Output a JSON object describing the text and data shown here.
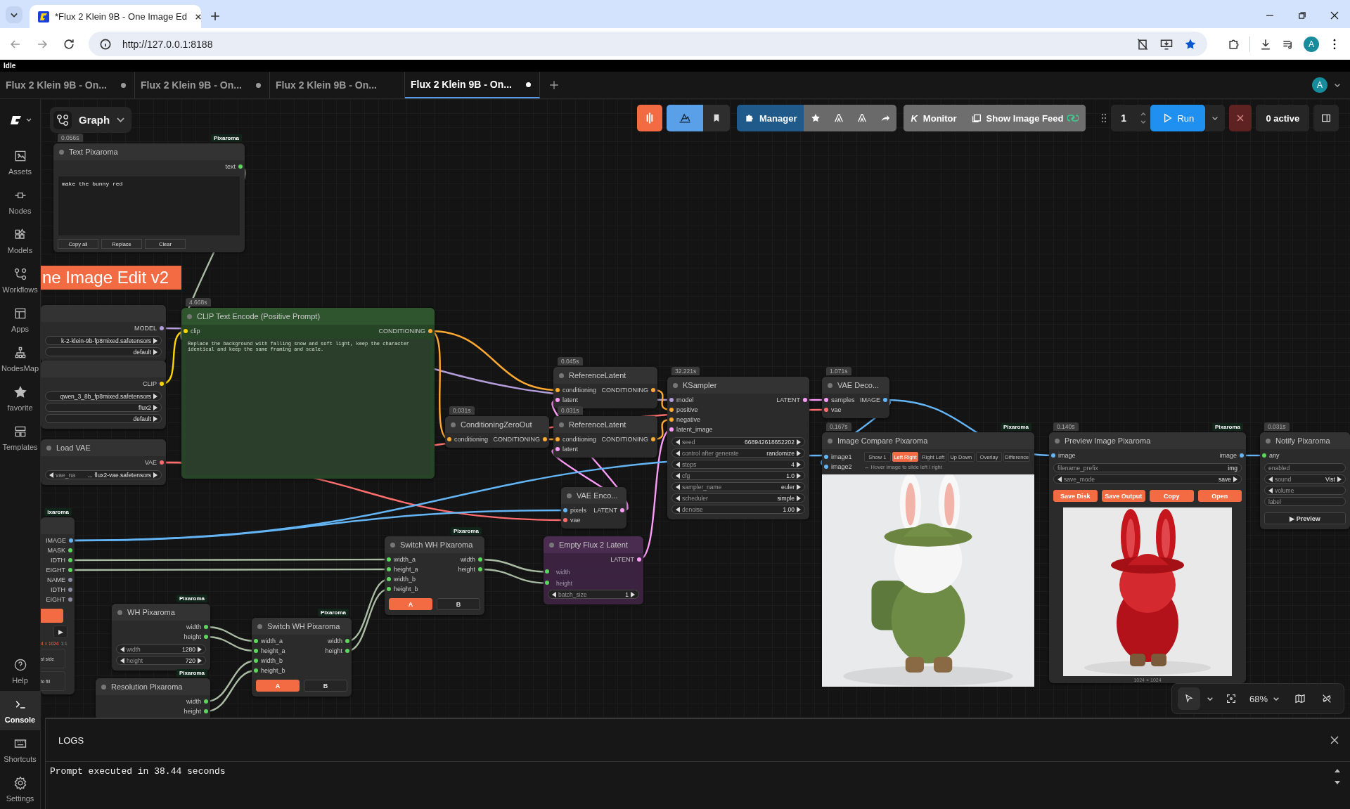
{
  "browser": {
    "tab_title": "*Flux 2 Klein 9B - One Image Ed",
    "url": "http://127.0.0.1:8188",
    "profile": "A"
  },
  "status": "Idle",
  "workflow_tabs": [
    {
      "label": "Flux 2 Klein 9B - On...",
      "unsaved": true,
      "selected": false
    },
    {
      "label": "Flux 2 Klein 9B - On...",
      "unsaved": true,
      "selected": false
    },
    {
      "label": "Flux 2 Klein 9B - On...",
      "unsaved": false,
      "selected": false
    },
    {
      "label": "Flux 2 Klein 9B - On...",
      "unsaved": true,
      "selected": true
    }
  ],
  "account": "A",
  "sidebar": {
    "items": [
      {
        "label": "Assets",
        "selected": false
      },
      {
        "label": "Nodes",
        "selected": false
      },
      {
        "label": "Models",
        "selected": false
      },
      {
        "label": "Workflows",
        "selected": false
      },
      {
        "label": "Apps",
        "selected": false
      },
      {
        "label": "NodesMap",
        "selected": false
      },
      {
        "label": "favorite",
        "selected": false
      },
      {
        "label": "Templates",
        "selected": false
      }
    ],
    "bottom_items": [
      {
        "label": "Help",
        "selected": false
      },
      {
        "label": "Console",
        "selected": true
      },
      {
        "label": "Shortcuts",
        "selected": false
      },
      {
        "label": "Settings",
        "selected": false
      }
    ]
  },
  "view_menu": "Graph",
  "toolbar": {
    "manager": "Manager",
    "monitor_mark": "K",
    "monitor": "Monitor",
    "image_feed": "Show Image Feed",
    "batch_count": "1",
    "run": "Run",
    "queue_status": "0 active"
  },
  "group_title": "ne Image Edit v2",
  "nodes": [
    {
      "kind": "text_editor",
      "title": "Text Pixaroma",
      "timing": "0.056s",
      "badge": "Pixaroma",
      "outputs": [
        {
          "label": "text",
          "color": "#5cd65c"
        }
      ],
      "text": "make the bunny red",
      "buttons": [
        {
          "label": "Copy all"
        },
        {
          "label": "Replace"
        },
        {
          "label": "Clear"
        }
      ]
    },
    {
      "kind": "standard",
      "outputs": [
        {
          "label": "MODEL",
          "color": "#b39ddb"
        }
      ],
      "widgets": [
        {
          "kind": "combo",
          "value": "k-2-klein-9b-fp8mixed.safetensors"
        },
        {
          "kind": "combo",
          "value": "default"
        }
      ]
    },
    {
      "kind": "standard",
      "outputs": [
        {
          "label": "CLIP",
          "color": "#ffd500"
        }
      ],
      "widgets": [
        {
          "kind": "combo",
          "value": "qwen_3_8b_fp8mixed.safetensors"
        },
        {
          "kind": "combo",
          "value": "flux2"
        },
        {
          "kind": "combo",
          "value": "default"
        }
      ]
    },
    {
      "kind": "standard",
      "title": "Load VAE",
      "outputs": [
        {
          "label": "VAE",
          "color": "#ff6e6e"
        }
      ],
      "widgets": [
        {
          "kind": "combo",
          "label": "vae_na",
          "value": "... flux2-vae.safetensors"
        }
      ]
    },
    {
      "kind": "prompt",
      "title": "CLIP Text Encode (Positive Prompt)",
      "timing": "4.668s",
      "color": "#2f552f",
      "inputs": [
        {
          "label": "clip",
          "color": "#ffd500"
        }
      ],
      "outputs": [
        {
          "label": "CONDITIONING",
          "color": "#ffa931"
        }
      ],
      "text": "Replace the background with falling snow and soft light, keep the character identical and keep the same framing and scale."
    },
    {
      "kind": "standard",
      "title": "ReferenceLatent",
      "timing": "0.045s",
      "inputs": [
        {
          "label": "conditioning",
          "color": "#ffa931"
        },
        {
          "label": "latent",
          "color": "#ff9cf9"
        }
      ],
      "outputs": [
        {
          "label": "CONDITIONING",
          "color": "#ffa931"
        }
      ]
    },
    {
      "kind": "standard",
      "title": "ConditioningZeroOut",
      "timing": "0.031s",
      "inputs": [
        {
          "label": "conditioning",
          "color": "#ffa931"
        }
      ],
      "outputs": [
        {
          "label": "CONDITIONING",
          "color": "#ffa931"
        }
      ]
    },
    {
      "kind": "standard",
      "title": "ReferenceLatent",
      "timing": "0.031s",
      "inputs": [
        {
          "label": "conditioning",
          "color": "#ffa931"
        },
        {
          "label": "latent",
          "color": "#ff9cf9"
        }
      ],
      "outputs": [
        {
          "label": "CONDITIONING",
          "color": "#ffa931"
        }
      ]
    },
    {
      "kind": "standard",
      "title": "KSampler",
      "timing": "32.221s",
      "inputs": [
        {
          "label": "model",
          "color": "#b39ddb"
        },
        {
          "label": "positive",
          "color": "#ffa931"
        },
        {
          "label": "negative",
          "color": "#ffa931"
        },
        {
          "label": "latent_image",
          "color": "#ff9cf9"
        }
      ],
      "outputs": [
        {
          "label": "LATENT",
          "color": "#ff9cf9"
        }
      ],
      "widgets": [
        {
          "kind": "combo",
          "label": "seed",
          "value": "668942618652202"
        },
        {
          "kind": "combo",
          "label": "control after generate",
          "value": "randomize"
        },
        {
          "kind": "combo",
          "label": "steps",
          "value": "4"
        },
        {
          "kind": "combo",
          "label": "cfg",
          "value": "1.0"
        },
        {
          "kind": "combo",
          "label": "sampler_name",
          "value": "euler"
        },
        {
          "kind": "combo",
          "label": "scheduler",
          "value": "simple"
        },
        {
          "kind": "combo",
          "label": "denoise",
          "value": "1.00"
        }
      ]
    },
    {
      "kind": "standard",
      "title": "VAE Deco...",
      "timing": "1.071s",
      "inputs": [
        {
          "label": "samples",
          "color": "#ff9cf9"
        },
        {
          "label": "vae",
          "color": "#ff6e6e"
        }
      ],
      "outputs": [
        {
          "label": "IMAGE",
          "color": "#64b5f6"
        }
      ]
    },
    {
      "kind": "standard",
      "title": "VAE Enco...",
      "inputs": [
        {
          "label": "pixels",
          "color": "#64b5f6"
        },
        {
          "label": "vae",
          "color": "#ff6e6e"
        }
      ],
      "outputs": [
        {
          "label": "LATENT",
          "color": "#ff9cf9"
        }
      ]
    },
    {
      "kind": "compare",
      "title": "Image Compare Pixaroma",
      "timing": "0.167s",
      "badge": "Pixaroma",
      "inputs": [
        {
          "label": "image1",
          "color": "#64b5f6"
        },
        {
          "label": "image2",
          "color": "#64b5f6"
        }
      ],
      "buttons": [
        {
          "label": "Show 1",
          "selected": false
        },
        {
          "label": "Left Right",
          "selected": true
        },
        {
          "label": "Right Left",
          "selected": false
        },
        {
          "label": "Up Down",
          "selected": false
        },
        {
          "label": "Overlay",
          "selected": false
        },
        {
          "label": "Difference",
          "selected": false
        }
      ],
      "hint": "↔ Hover image to slide left / right"
    },
    {
      "kind": "preview",
      "title": "Preview Image Pixaroma",
      "timing": "0.140s",
      "badge": "Pixaroma",
      "inputs": [
        {
          "label": "image",
          "color": "#64b5f6"
        }
      ],
      "outputs": [
        {
          "label": "image",
          "color": "#64b5f6"
        }
      ],
      "widgets": [
        {
          "kind": "text",
          "label": "filename_prefix",
          "value": "img"
        },
        {
          "kind": "combo",
          "label": "save_mode",
          "value": "save"
        }
      ],
      "buttons": [
        {
          "label": "Save Disk",
          "kind": "accent"
        },
        {
          "label": "Save Output",
          "kind": "accent"
        },
        {
          "label": "Copy",
          "kind": "accent"
        },
        {
          "label": "Open",
          "kind": "accent"
        }
      ],
      "caption": "1024 × 1024"
    },
    {
      "kind": "standard",
      "title": "Notify Pixaroma",
      "timing": "0.031s",
      "inputs": [
        {
          "label": "any",
          "color": "#5cd65c"
        }
      ],
      "widgets": [
        {
          "kind": "text",
          "label": "enabled"
        },
        {
          "kind": "combo",
          "label": "sound",
          "value": "Vist"
        },
        {
          "kind": "combo",
          "label": "volume"
        },
        {
          "kind": "text",
          "label": "label"
        }
      ],
      "buttons": [
        {
          "label": "▶ Preview"
        }
      ]
    },
    {
      "kind": "image_loader",
      "badge": "ixaroma",
      "outputs": [
        {
          "label": "IMAGE",
          "color": "#64b5f6"
        },
        {
          "label": "MASK",
          "color": "#5cd65c"
        },
        {
          "label": "IDTH",
          "color": "#5cd65c"
        },
        {
          "label": "EIGHT",
          "color": "#5cd65c"
        },
        {
          "label": "NAME",
          "color": "#8a8aa0"
        },
        {
          "label": "IDTH",
          "color": "#8a8aa0"
        },
        {
          "label": "EIGHT",
          "color": "#8a8aa0"
        }
      ],
      "extras": [
        {
          "kind": "accent"
        },
        {
          "kind": "play",
          "label": "▶"
        },
        {
          "kind": "note",
          "label": "4 × 1024",
          "ratio": "1:1"
        },
        {
          "kind": "option",
          "label": "st side"
        },
        {
          "kind": "option",
          "label": "to fill"
        }
      ]
    },
    {
      "kind": "switch",
      "title": "Switch WH Pixaroma",
      "badge": "Pixaroma",
      "inputs": [
        {
          "label": "width_a",
          "color": "#5cd65c"
        },
        {
          "label": "height_a",
          "color": "#5cd65c"
        },
        {
          "label": "width_b",
          "color": "#5cd65c"
        },
        {
          "label": "height_b",
          "color": "#5cd65c"
        }
      ],
      "outputs": [
        {
          "label": "width",
          "color": "#5cd65c"
        },
        {
          "label": "height",
          "color": "#5cd65c"
        }
      ],
      "buttons": [
        {
          "label": "A",
          "selected": true
        },
        {
          "label": "B",
          "selected": false
        }
      ]
    },
    {
      "kind": "standard",
      "title": "Empty Flux 2 Latent",
      "color": "#4a2c50",
      "outputs": [
        {
          "label": "LATENT",
          "color": "#ff9cf9"
        }
      ],
      "widgets": [
        {
          "kind": "linked",
          "label": "width",
          "color": "#5cd65c"
        },
        {
          "kind": "linked",
          "label": "height",
          "color": "#5cd65c"
        },
        {
          "kind": "combo",
          "label": "batch_size",
          "value": "1"
        }
      ]
    },
    {
      "kind": "standard",
      "title": "WH Pixaroma",
      "badge": "Pixaroma",
      "outputs": [
        {
          "label": "width",
          "color": "#5cd65c"
        },
        {
          "label": "height",
          "color": "#5cd65c"
        }
      ],
      "widgets": [
        {
          "kind": "combo",
          "label": "width",
          "value": "1280"
        },
        {
          "kind": "combo",
          "label": "height",
          "value": "720"
        }
      ]
    },
    {
      "kind": "switch",
      "title": "Switch WH Pixaroma",
      "badge": "Pixaroma",
      "inputs": [
        {
          "label": "width_a",
          "color": "#5cd65c"
        },
        {
          "label": "height_a",
          "color": "#5cd65c"
        },
        {
          "label": "width_b",
          "color": "#5cd65c"
        },
        {
          "label": "height_b",
          "color": "#5cd65c"
        }
      ],
      "outputs": [
        {
          "label": "width",
          "color": "#5cd65c"
        },
        {
          "label": "height",
          "color": "#5cd65c"
        }
      ],
      "buttons": [
        {
          "label": "A",
          "selected": true
        },
        {
          "label": "B",
          "selected": false
        }
      ]
    },
    {
      "kind": "standard",
      "title": "Resolution Pixaroma",
      "badge": "Pixaroma",
      "outputs": [
        {
          "label": "width",
          "color": "#5cd65c"
        },
        {
          "label": "height",
          "color": "#5cd65c"
        }
      ]
    }
  ],
  "canvas_controls": {
    "zoom": "68%"
  },
  "logs": {
    "title": "LOGS",
    "lines": [
      "Prompt executed in 38.44 seconds"
    ]
  }
}
